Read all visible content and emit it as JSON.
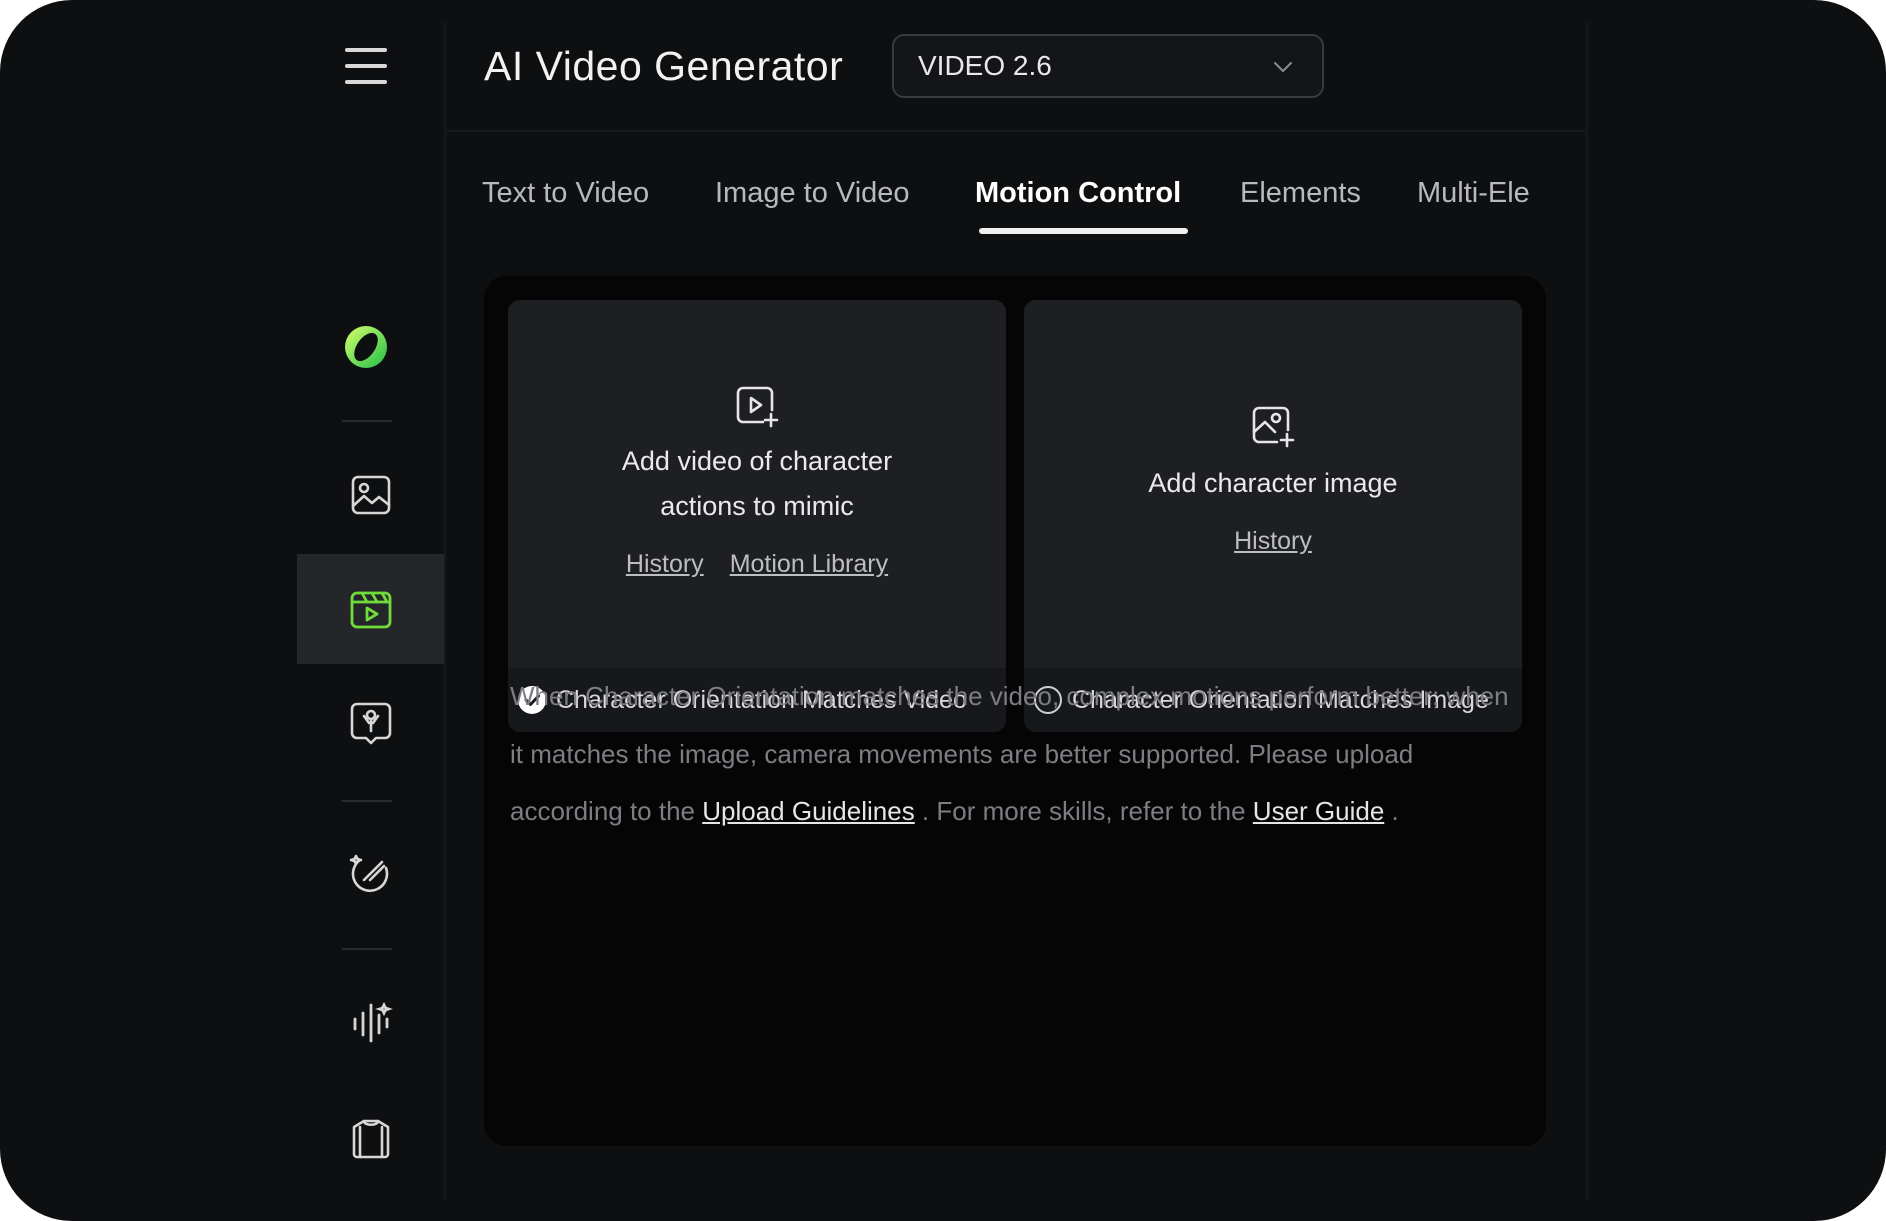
{
  "app": {
    "title": "AI Video Generator",
    "model_selected": "VIDEO 2.6"
  },
  "sidebar": {
    "items": [
      {
        "name": "logo",
        "icon": "app-logo-icon"
      },
      {
        "name": "image",
        "icon": "image-icon"
      },
      {
        "name": "video",
        "icon": "video-clapper-icon",
        "active": true
      },
      {
        "name": "avatar",
        "icon": "avatar-bubble-icon"
      },
      {
        "name": "effects",
        "icon": "magic-effects-icon"
      },
      {
        "name": "audio",
        "icon": "audio-wave-icon"
      },
      {
        "name": "apparel",
        "icon": "shirt-icon"
      }
    ],
    "accent_color": "#6fdc3c"
  },
  "tabs": [
    {
      "label": "Text to Video"
    },
    {
      "label": "Image to Video"
    },
    {
      "label": "Motion Control",
      "active": true
    },
    {
      "label": "Elements"
    },
    {
      "label": "Multi-Ele"
    }
  ],
  "motion_control": {
    "video_card": {
      "title_line1": "Add video of character",
      "title_line2": "actions to mimic",
      "link_history": "History",
      "link_library": "Motion Library",
      "option_label": "Character Orientation Matches Video",
      "option_checked": true
    },
    "image_card": {
      "title": "Add character image",
      "link_history": "History",
      "option_label": "Character Orientation Matches Image",
      "option_checked": false
    },
    "info": {
      "text1": "When Character Orientation matches the video, complex motions perform better; when it matches the image, camera movements are better supported. Please upload according to the ",
      "link1": "Upload Guidelines",
      "text2": " . For more skills, refer to the ",
      "link2": "User Guide",
      "text3": " ."
    }
  }
}
